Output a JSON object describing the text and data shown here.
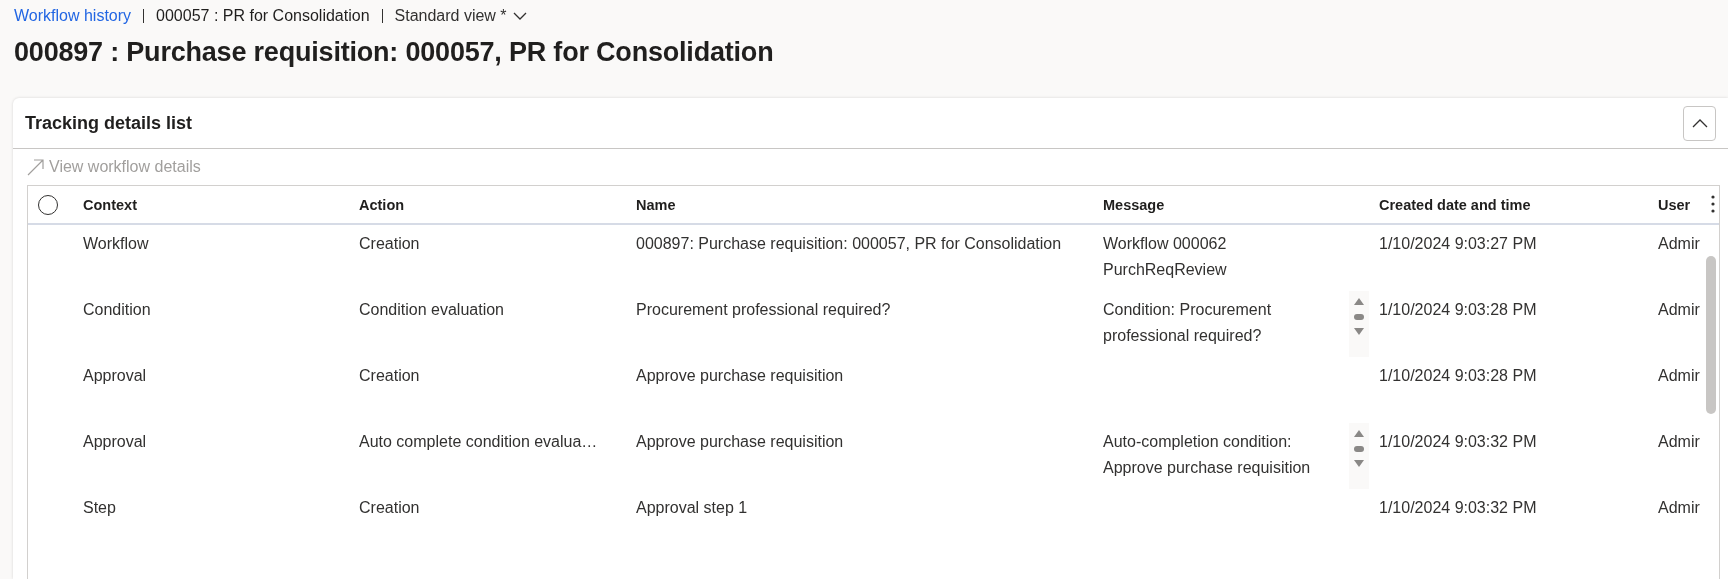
{
  "breadcrumb": {
    "link": "Workflow history",
    "record": "000057 : PR for Consolidation",
    "view": "Standard view *"
  },
  "title": "000897 : Purchase requisition: 000057, PR for Consolidation",
  "card": {
    "title": "Tracking details list",
    "expanded": true,
    "toolbar": {
      "label": "View workflow details",
      "disabled": true
    },
    "grid": {
      "select_all_checked": false,
      "columns": [
        "Context",
        "Action",
        "Name",
        "Message",
        "Created date and time",
        "User"
      ],
      "rows": [
        {
          "cells": [
            "Workflow",
            "Creation",
            "000897: Purchase requisition: 000057, PR for Consolidation",
            "Workflow 000062 PurchReqReview",
            "1/10/2024 9:03:27 PM",
            "Admir"
          ],
          "scroll_controls": false
        },
        {
          "cells": [
            "Condition",
            "Condition evaluation",
            "Procurement professional required?",
            "Condition: Procurement professional required?",
            "1/10/2024 9:03:28 PM",
            "Admir"
          ],
          "scroll_controls": true
        },
        {
          "cells": [
            "Approval",
            "Creation",
            "Approve purchase requisition",
            "",
            "1/10/2024 9:03:28 PM",
            "Admir"
          ],
          "scroll_controls": false
        },
        {
          "cells": [
            "Approval",
            "Auto complete condition evalua…",
            "Approve purchase requisition",
            "Auto-completion condition: Approve purchase requisition",
            "1/10/2024 9:03:32 PM",
            "Admir"
          ],
          "scroll_controls": true
        },
        {
          "cells": [
            "Step",
            "Creation",
            "Approval step 1",
            "",
            "1/10/2024 9:03:32 PM",
            "Admir"
          ],
          "scroll_controls": false
        }
      ]
    }
  }
}
